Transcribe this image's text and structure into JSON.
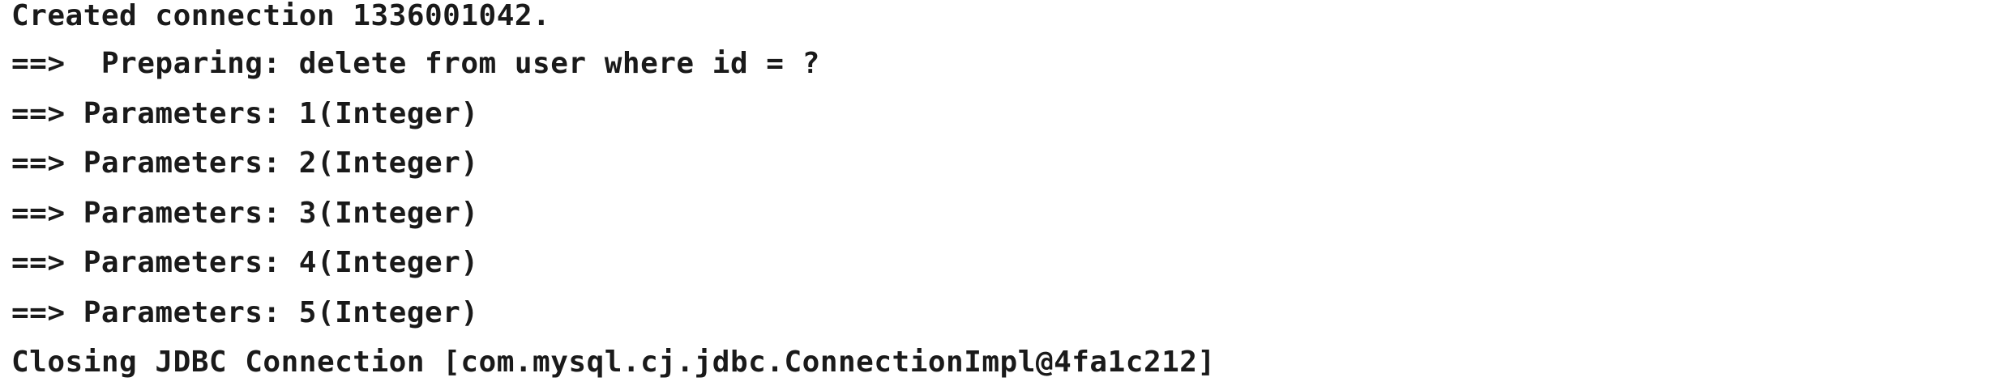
{
  "console": {
    "lines": [
      "Created connection 1336001042.",
      "==>  Preparing: delete from user where id = ?",
      "==> Parameters: 1(Integer)",
      "==> Parameters: 2(Integer)",
      "==> Parameters: 3(Integer)",
      "==> Parameters: 4(Integer)",
      "==> Parameters: 5(Integer)",
      "Closing JDBC Connection [com.mysql.cj.jdbc.ConnectionImpl@4fa1c212]"
    ]
  }
}
